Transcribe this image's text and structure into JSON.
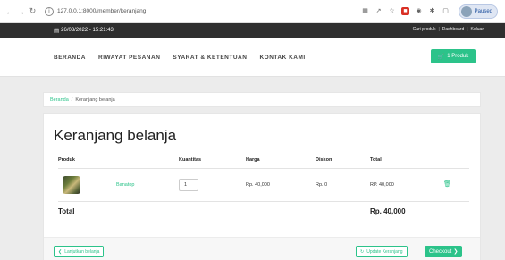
{
  "browser": {
    "url": "127.0.0.1:8000/member/keranjang",
    "profile_label": "Paused"
  },
  "topbar": {
    "datetime": "26/03/2022 - 15:21:43",
    "links": [
      "Cari produk",
      "Dashboard",
      "Keluar"
    ],
    "separator": "|"
  },
  "nav": {
    "items": [
      "BERANDA",
      "RIWAYAT PESANAN",
      "SYARAT & KETENTUAN",
      "KONTAK KAMI"
    ],
    "cart_label": "1 Produk"
  },
  "breadcrumb": {
    "home": "Beranda",
    "separator": "/",
    "current": "Keranjang belanja"
  },
  "page": {
    "title": "Keranjang belanja"
  },
  "table": {
    "headers": [
      "Produk",
      "Kuantitas",
      "Harga",
      "Diskon",
      "Total"
    ],
    "rows": [
      {
        "name": "Banatop",
        "quantity": "1",
        "price": "Rp. 40,000",
        "discount": "Rp. 0",
        "total": "RP. 40,000"
      }
    ],
    "total_label": "Total",
    "total_value": "Rp. 40,000"
  },
  "actions": {
    "continue": "Lanjutkan belanja",
    "update": "Update Keranjang",
    "checkout": "Checkout"
  },
  "colors": {
    "accent": "#2cc38a",
    "topbar": "#2f2f2f"
  }
}
